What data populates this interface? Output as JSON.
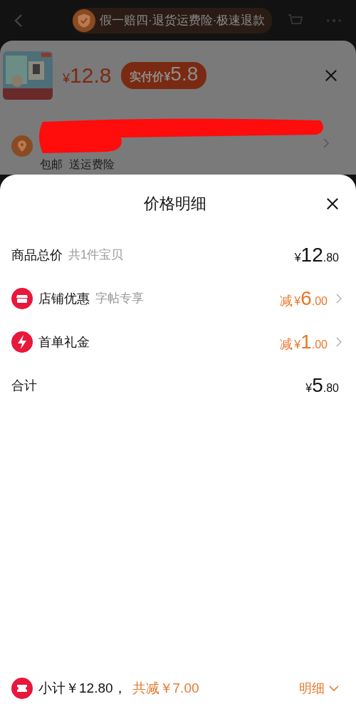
{
  "header": {
    "banner": "假一赔四·退货运费险·极速退款"
  },
  "product": {
    "price": {
      "currency": "¥",
      "amount": "12.8"
    },
    "final_price": {
      "label": "实付价",
      "currency": "¥",
      "amount": "5.8"
    },
    "shipping": "包邮  送运费险"
  },
  "sheet": {
    "title": "价格明细",
    "rows": [
      {
        "kind": "total",
        "label": "商品总价",
        "note": "共1件宝贝",
        "prefix": "",
        "currency": "¥",
        "integer": "12",
        "decimal": ".80"
      },
      {
        "kind": "shop",
        "label": "店铺优惠",
        "note": "字帖专享",
        "prefix": "减",
        "currency": "¥",
        "integer": "6",
        "decimal": ".00"
      },
      {
        "kind": "lightning",
        "label": "首单礼金",
        "note": "",
        "prefix": "减",
        "currency": "¥",
        "integer": "1",
        "decimal": ".00"
      },
      {
        "kind": "total",
        "label": "合计",
        "note": "",
        "prefix": "",
        "currency": "¥",
        "integer": "5",
        "decimal": ".80"
      }
    ]
  },
  "footer": {
    "subtotal": "小计￥12.80，",
    "saving": "共减￥7.00",
    "details": "明细"
  }
}
